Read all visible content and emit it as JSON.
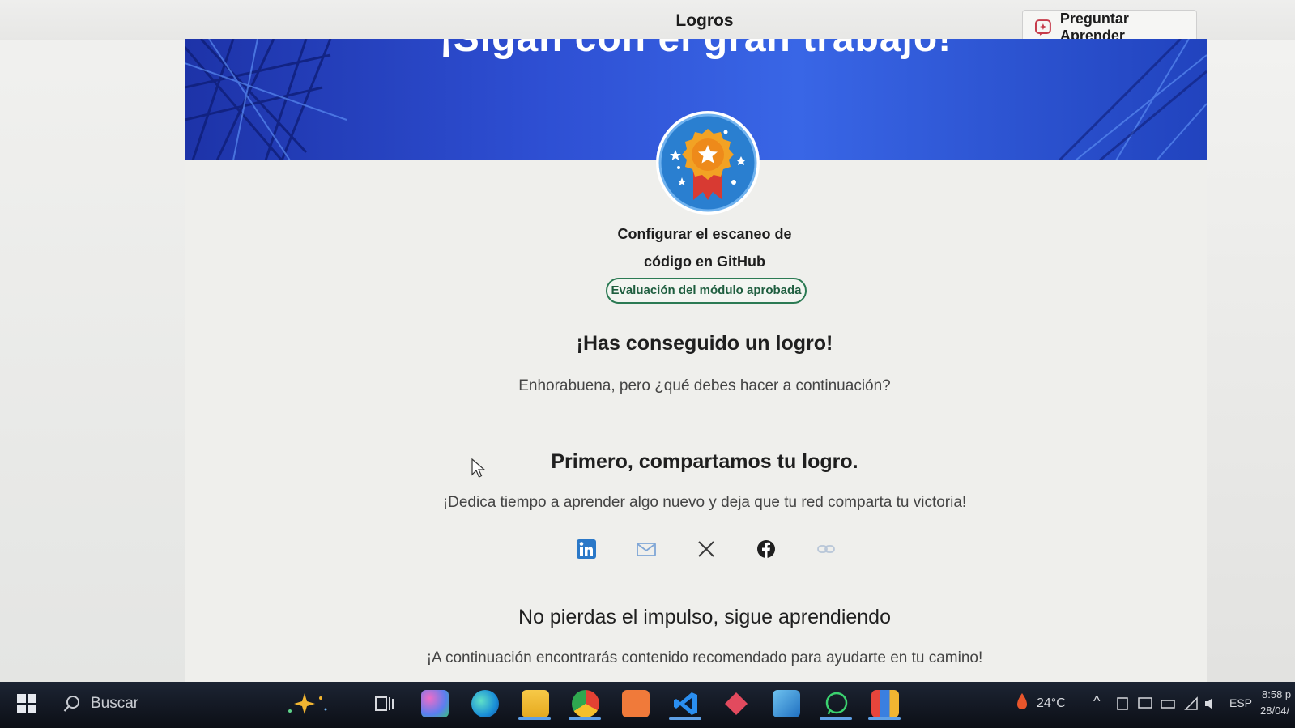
{
  "window": {
    "title": "Logros",
    "ask_button": "Preguntar Aprender"
  },
  "banner": {
    "text": "¡Sigan con el gran trabajo!"
  },
  "achievement": {
    "module_title_line1": "Configurar el escaneo de",
    "module_title_line2": "código en GitHub",
    "status_pill": "Evaluación del módulo aprobada"
  },
  "congrats": {
    "heading": "¡Has conseguido un logro!",
    "subtitle": "Enhorabuena, pero ¿qué debes hacer a continuación?"
  },
  "share": {
    "heading": "Primero, compartamos tu logro.",
    "subtitle": "¡Dedica tiempo a aprender algo nuevo y deja que tu red comparta tu victoria!",
    "icons": [
      "linkedin-icon",
      "mail-icon",
      "x-icon",
      "facebook-icon",
      "link-icon"
    ]
  },
  "keep_going": {
    "heading": "No pierdas el impulso, sigue aprendiendo",
    "subtitle": "¡A continuación encontrarás contenido recomendado para ayudarte en tu camino!"
  },
  "taskbar": {
    "search_label": "Buscar",
    "temperature": "24°C",
    "language": "ESP",
    "time": "8:58 p",
    "date": "28/04/"
  },
  "colors": {
    "banner": "#2e4fd3",
    "pill_border": "#2b7a53",
    "badge_blue": "#2a7fd0",
    "badge_gold": "#f2a224"
  }
}
